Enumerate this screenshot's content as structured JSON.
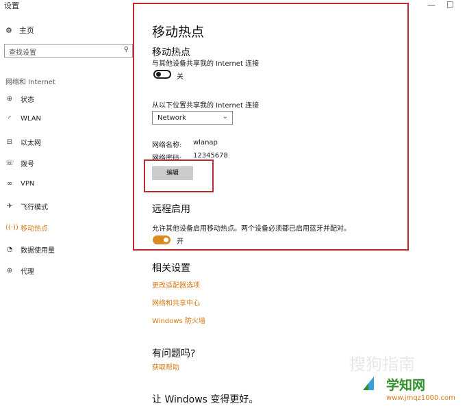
{
  "window": {
    "title": "设置",
    "minimize": "—",
    "maximize": "☐"
  },
  "sidebar": {
    "home": "主页",
    "search_placeholder": "查找设置",
    "section": "网络和 Internet",
    "items": [
      {
        "label": "状态",
        "icon": "globe-icon"
      },
      {
        "label": "WLAN",
        "icon": "wifi-icon"
      },
      {
        "label": "以太网",
        "icon": "ethernet-icon"
      },
      {
        "label": "拨号",
        "icon": "dialup-icon"
      },
      {
        "label": "VPN",
        "icon": "vpn-icon"
      },
      {
        "label": "飞行模式",
        "icon": "airplane-icon"
      },
      {
        "label": "移动热点",
        "icon": "hotspot-icon",
        "active": true
      },
      {
        "label": "数据使用量",
        "icon": "data-usage-icon"
      },
      {
        "label": "代理",
        "icon": "proxy-globe-icon"
      }
    ]
  },
  "main": {
    "page_title": "移动热点",
    "hotspot": {
      "heading": "移动热点",
      "desc": "与其他设备共享我的 Internet 连接",
      "toggle_label": "关",
      "toggle_on": false
    },
    "share_from": {
      "label": "从以下位置共享我的 Internet 连接",
      "selected": "Network"
    },
    "network": {
      "name_label": "网络名称:",
      "name_value": "wlanap",
      "password_label": "网络密码:",
      "password_value": "12345678",
      "edit_button": "编辑"
    },
    "remote": {
      "heading": "远程启用",
      "desc": "允许其他设备启用移动热点。两个设备必须都已启用蓝牙并配对。",
      "toggle_label": "开",
      "toggle_on": true
    },
    "related": {
      "heading": "相关设置",
      "links": [
        "更改适配器选项",
        "网络和共享中心",
        "Windows 防火墙"
      ]
    },
    "help": {
      "heading": "有问题吗?",
      "link": "获取帮助"
    },
    "feedback_heading": "让 Windows 变得更好。"
  },
  "watermark": {
    "sogou": "搜狗指南",
    "brand": "学知网",
    "url": "www.jmqz1000.com"
  },
  "colors": {
    "accent": "#d77a16",
    "highlight_box": "#c0282e",
    "toggle_on": "#d98a23"
  }
}
